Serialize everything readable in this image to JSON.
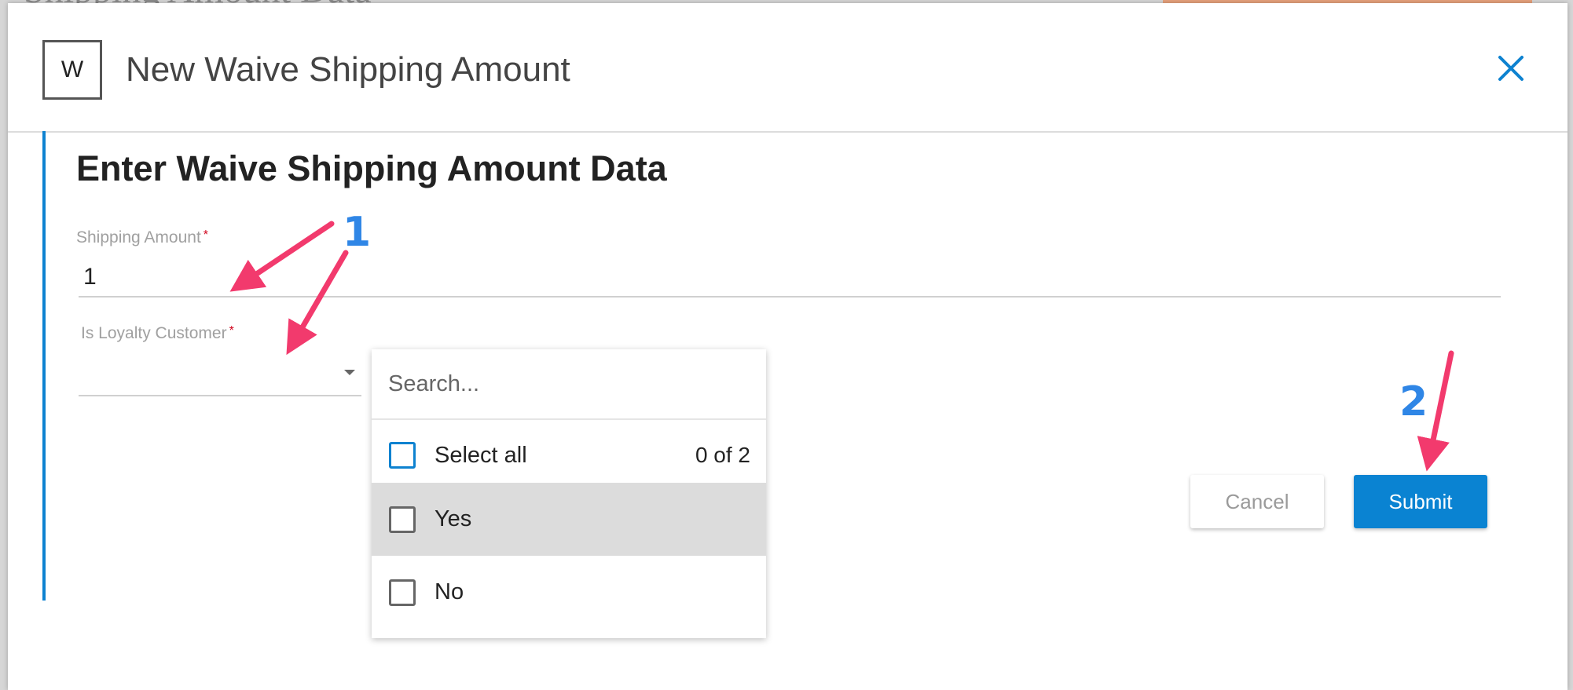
{
  "background": {
    "title": "Shipping Amount Data"
  },
  "modal": {
    "badge": "W",
    "title": "New Waive Shipping Amount",
    "close_icon": "close-icon"
  },
  "form": {
    "section_title": "Enter Waive Shipping Amount Data",
    "shipping_amount": {
      "label": "Shipping Amount",
      "required_mark": "*",
      "value": "1"
    },
    "is_loyalty_customer": {
      "label": "Is Loyalty Customer",
      "required_mark": "*",
      "selected_value": ""
    }
  },
  "dropdown": {
    "search_placeholder": "Search...",
    "select_all_label": "Select all",
    "count_text": "0 of 2",
    "options": [
      {
        "label": "Yes",
        "checked": false,
        "highlighted": true
      },
      {
        "label": "No",
        "checked": false,
        "highlighted": false
      }
    ]
  },
  "buttons": {
    "cancel_label": "Cancel",
    "submit_label": "Submit"
  },
  "annotations": {
    "marker_1": "1",
    "marker_2": "2",
    "arrow_color": "#f23a6d"
  },
  "colors": {
    "accent": "#0d82d0",
    "submit_bg": "#0a83d2",
    "highlight_row": "#dcdcdc",
    "required": "#d0021b"
  }
}
